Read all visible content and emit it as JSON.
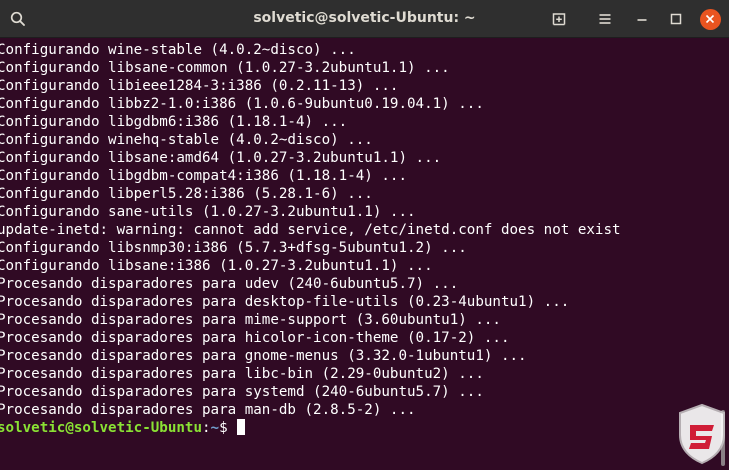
{
  "window": {
    "title": "solvetic@solvetic-Ubuntu: ~"
  },
  "header": {
    "icons": [
      "search-icon",
      "new-tab-icon",
      "menu-icon",
      "minimize-icon",
      "maximize-icon",
      "close-icon"
    ]
  },
  "colors": {
    "terminal_bg": "#300a24",
    "prompt_user": "#8ae234",
    "prompt_path": "#729fcf",
    "close_button": "#e95420"
  },
  "terminal": {
    "lines": [
      "Configurando wine-stable (4.0.2~disco) ...",
      "Configurando libsane-common (1.0.27-3.2ubuntu1.1) ...",
      "Configurando libieee1284-3:i386 (0.2.11-13) ...",
      "Configurando libbz2-1.0:i386 (1.0.6-9ubuntu0.19.04.1) ...",
      "Configurando libgdbm6:i386 (1.18.1-4) ...",
      "Configurando winehq-stable (4.0.2~disco) ...",
      "Configurando libsane:amd64 (1.0.27-3.2ubuntu1.1) ...",
      "Configurando libgdbm-compat4:i386 (1.18.1-4) ...",
      "Configurando libperl5.28:i386 (5.28.1-6) ...",
      "Configurando sane-utils (1.0.27-3.2ubuntu1.1) ...",
      "update-inetd: warning: cannot add service, /etc/inetd.conf does not exist",
      "Configurando libsnmp30:i386 (5.7.3+dfsg-5ubuntu1.2) ...",
      "Configurando libsane:i386 (1.0.27-3.2ubuntu1.1) ...",
      "Procesando disparadores para udev (240-6ubuntu5.7) ...",
      "Procesando disparadores para desktop-file-utils (0.23-4ubuntu1) ...",
      "Procesando disparadores para mime-support (3.60ubuntu1) ...",
      "Procesando disparadores para hicolor-icon-theme (0.17-2) ...",
      "Procesando disparadores para gnome-menus (3.32.0-1ubuntu1) ...",
      "Procesando disparadores para libc-bin (2.29-0ubuntu2) ...",
      "Procesando disparadores para systemd (240-6ubuntu5.7) ...",
      "Procesando disparadores para man-db (2.8.5-2) ..."
    ],
    "prompt": {
      "user_host": "solvetic@solvetic-Ubuntu",
      "colon": ":",
      "path": "~",
      "symbol": "$ "
    }
  }
}
